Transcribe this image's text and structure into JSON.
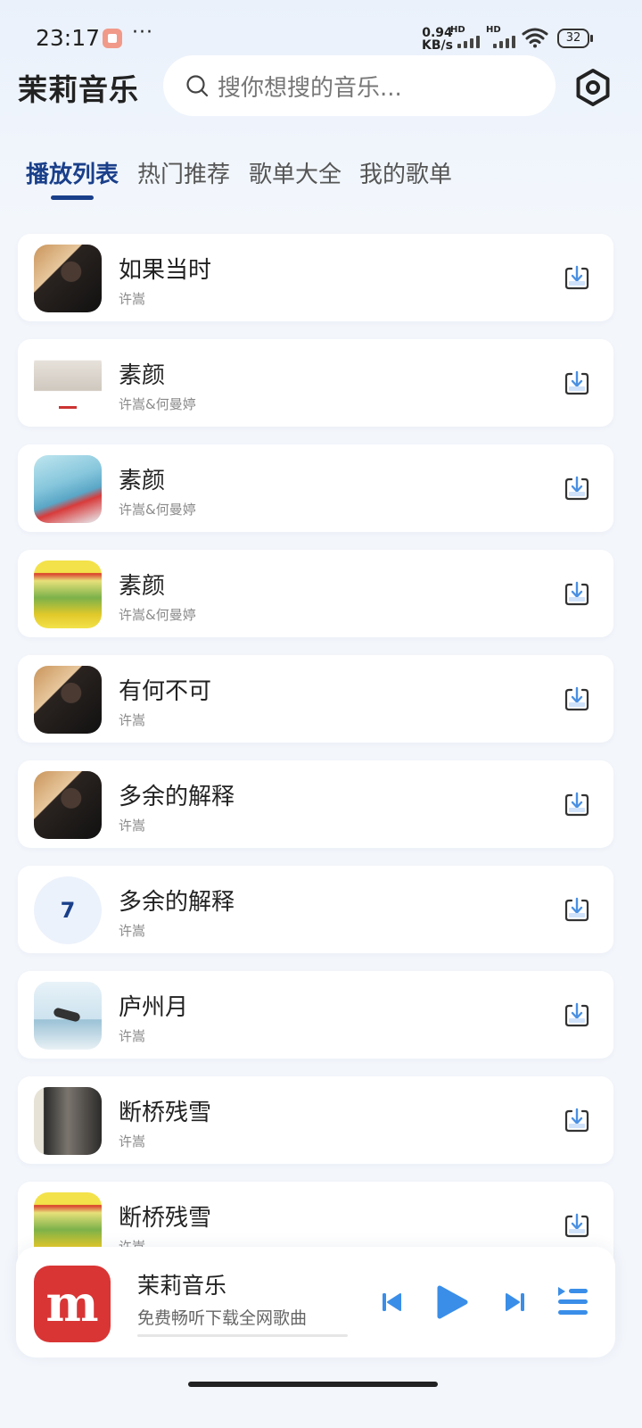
{
  "status_bar": {
    "time": "23:17",
    "more": "···",
    "net_speed_value": "0.94",
    "net_speed_unit": "KB/s",
    "hd_label": "HD",
    "battery": "32"
  },
  "header": {
    "app_title": "茉莉音乐",
    "search_placeholder": "搜你想搜的音乐..."
  },
  "tabs": [
    {
      "label": "播放列表",
      "active": true
    },
    {
      "label": "热门推荐",
      "active": false
    },
    {
      "label": "歌单大全",
      "active": false
    },
    {
      "label": "我的歌单",
      "active": false
    }
  ],
  "songs": [
    {
      "title": "如果当时",
      "artist": "许嵩",
      "cover": "portrait"
    },
    {
      "title": "素颜",
      "artist": "许嵩&何曼婷",
      "cover": "white"
    },
    {
      "title": "素颜",
      "artist": "许嵩&何曼婷",
      "cover": "blue"
    },
    {
      "title": "素颜",
      "artist": "许嵩&何曼婷",
      "cover": "yellow"
    },
    {
      "title": "有何不可",
      "artist": "许嵩",
      "cover": "portrait"
    },
    {
      "title": "多余的解释",
      "artist": "许嵩",
      "cover": "portrait"
    },
    {
      "title": "多余的解释",
      "artist": "许嵩",
      "cover": "number",
      "cover_text": "7"
    },
    {
      "title": "庐州月",
      "artist": "许嵩",
      "cover": "sky"
    },
    {
      "title": "断桥残雪",
      "artist": "许嵩",
      "cover": "dark"
    },
    {
      "title": "断桥残雪",
      "artist": "许嵩",
      "cover": "yellow"
    }
  ],
  "player": {
    "logo_text": "m",
    "title": "茉莉音乐",
    "subtitle": "免费畅听下载全网歌曲",
    "progress": 0
  },
  "colors": {
    "accent": "#1a3f8a",
    "play_blue": "#3a8ee8",
    "logo_red": "#d93535"
  }
}
